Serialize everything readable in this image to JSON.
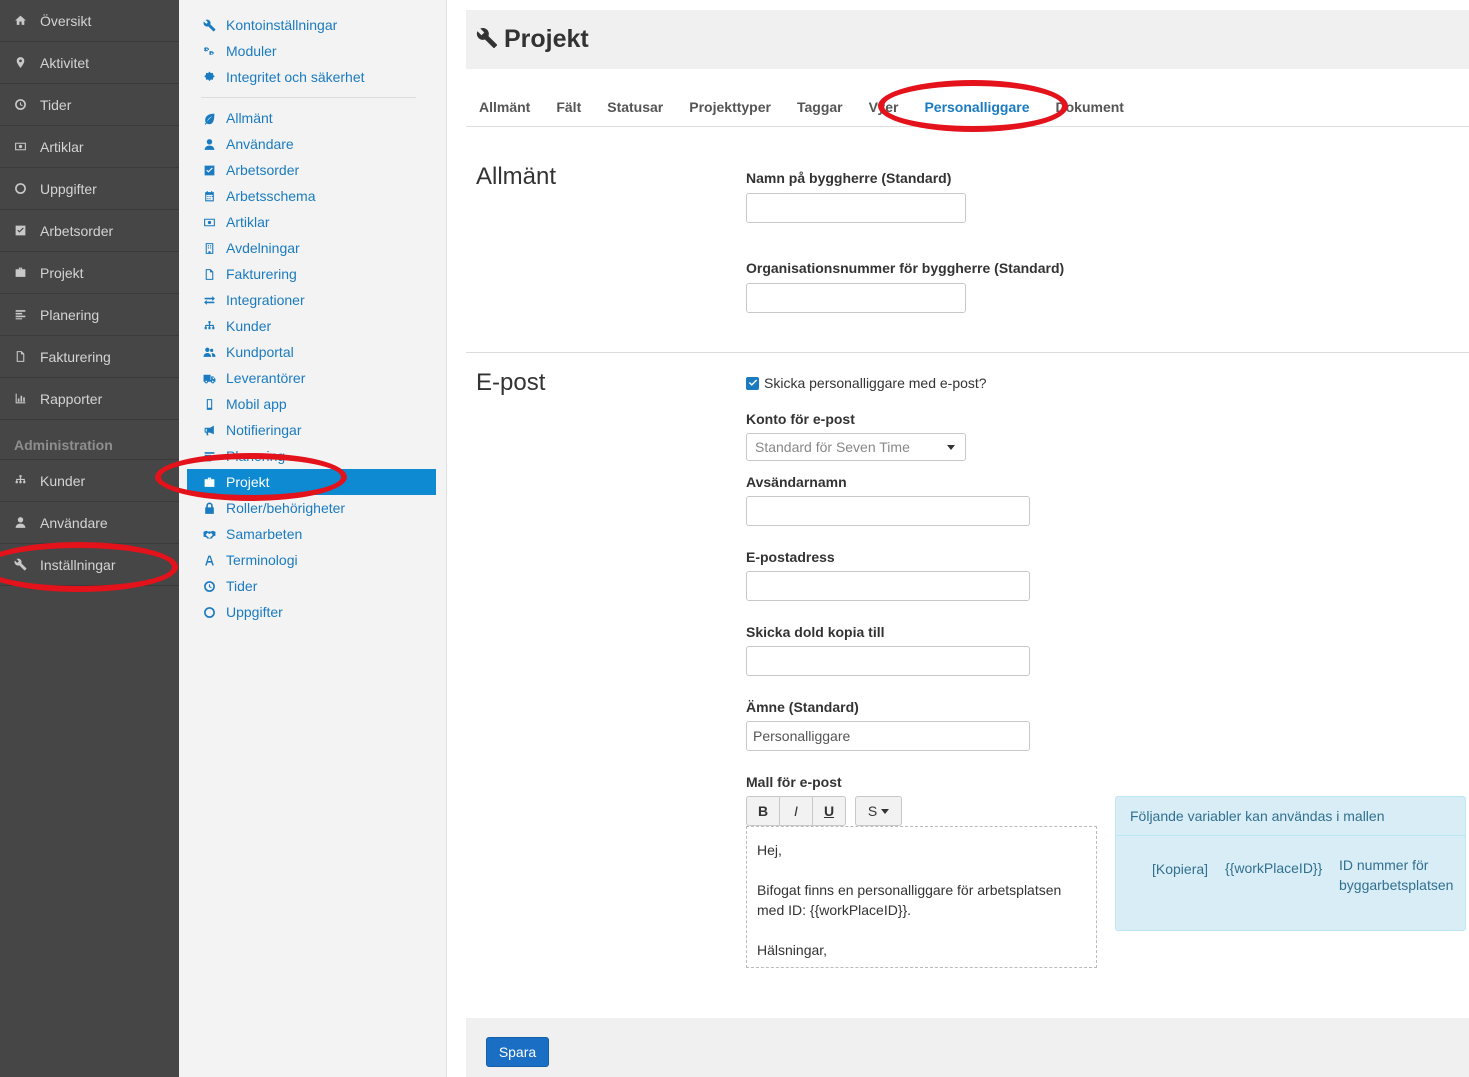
{
  "sidebar": {
    "items": [
      {
        "label": "Översikt",
        "icon": "home-icon"
      },
      {
        "label": "Aktivitet",
        "icon": "map-marker-icon"
      },
      {
        "label": "Tider",
        "icon": "clock-icon"
      },
      {
        "label": "Artiklar",
        "icon": "money-icon"
      },
      {
        "label": "Uppgifter",
        "icon": "circle-icon"
      },
      {
        "label": "Arbetsorder",
        "icon": "check-square-icon"
      },
      {
        "label": "Projekt",
        "icon": "briefcase-icon"
      },
      {
        "label": "Planering",
        "icon": "align-left-icon"
      },
      {
        "label": "Fakturering",
        "icon": "file-icon"
      },
      {
        "label": "Rapporter",
        "icon": "bar-chart-icon"
      }
    ],
    "section": "Administration",
    "admin_items": [
      {
        "label": "Kunder",
        "icon": "sitemap-icon"
      },
      {
        "label": "Användare",
        "icon": "user-icon"
      },
      {
        "label": "Inställningar",
        "icon": "wrench-icon"
      }
    ]
  },
  "subnav": {
    "group1": [
      {
        "label": "Kontoinställningar",
        "icon": "wrench-icon"
      },
      {
        "label": "Moduler",
        "icon": "cogs-icon"
      },
      {
        "label": "Integritet och säkerhet",
        "icon": "certificate-icon"
      }
    ],
    "group2": [
      {
        "label": "Allmänt",
        "icon": "leaf-icon"
      },
      {
        "label": "Användare",
        "icon": "user-icon"
      },
      {
        "label": "Arbetsorder",
        "icon": "check-square-icon"
      },
      {
        "label": "Arbetsschema",
        "icon": "calendar-icon"
      },
      {
        "label": "Artiklar",
        "icon": "money-icon"
      },
      {
        "label": "Avdelningar",
        "icon": "building-icon"
      },
      {
        "label": "Fakturering",
        "icon": "file-icon"
      },
      {
        "label": "Integrationer",
        "icon": "exchange-icon"
      },
      {
        "label": "Kunder",
        "icon": "sitemap-icon"
      },
      {
        "label": "Kundportal",
        "icon": "users-icon"
      },
      {
        "label": "Leverantörer",
        "icon": "truck-icon"
      },
      {
        "label": "Mobil app",
        "icon": "mobile-icon"
      },
      {
        "label": "Notifieringar",
        "icon": "bullhorn-icon"
      },
      {
        "label": "Planering",
        "icon": "align-left-icon"
      },
      {
        "label": "Projekt",
        "icon": "briefcase-icon",
        "active": true
      },
      {
        "label": "Roller/behörigheter",
        "icon": "lock-icon"
      },
      {
        "label": "Samarbeten",
        "icon": "handshake-icon"
      },
      {
        "label": "Terminologi",
        "icon": "font-icon"
      },
      {
        "label": "Tider",
        "icon": "clock-icon"
      },
      {
        "label": "Uppgifter",
        "icon": "circle-icon"
      }
    ]
  },
  "page": {
    "title": "Projekt",
    "tabs": [
      "Allmänt",
      "Fält",
      "Statusar",
      "Projekttyper",
      "Taggar",
      "Vyer",
      "Personalliggare",
      "Dokument"
    ],
    "active_tab": "Personalliggare"
  },
  "general": {
    "title": "Allmänt",
    "client_name_label": "Namn på byggherre (Standard)",
    "client_name_value": "",
    "org_number_label": "Organisationsnummer för byggherre (Standard)",
    "org_number_value": ""
  },
  "email": {
    "title": "E-post",
    "send_checkbox_label": "Skicka personalliggare med e-post?",
    "send_checked": true,
    "account_label": "Konto för e-post",
    "account_value": "Standard för Seven Time",
    "sender_name_label": "Avsändarnamn",
    "sender_name_value": "",
    "email_address_label": "E-postadress",
    "email_address_value": "",
    "bcc_label": "Skicka dold kopia till",
    "bcc_value": "",
    "subject_label": "Ämne (Standard)",
    "subject_value": "Personalliggare",
    "template_label": "Mall för e-post",
    "toolbar": {
      "bold": "B",
      "italic": "I",
      "underline": "U",
      "style": "S"
    },
    "template_lines": [
      "Hej,",
      "",
      "Bifogat finns en personalliggare för arbetsplatsen med ID: {{workPlaceID}}.",
      "",
      "Hälsningar,"
    ]
  },
  "variables": {
    "header": "Följande variabler kan användas i mallen",
    "rows": [
      {
        "copy": "[Kopiera]",
        "var": "{{workPlaceID}}",
        "desc": "ID nummer för byggarbetsplatsen"
      }
    ]
  },
  "footer": {
    "save_label": "Spara"
  },
  "annotation_color": "#e3121b"
}
